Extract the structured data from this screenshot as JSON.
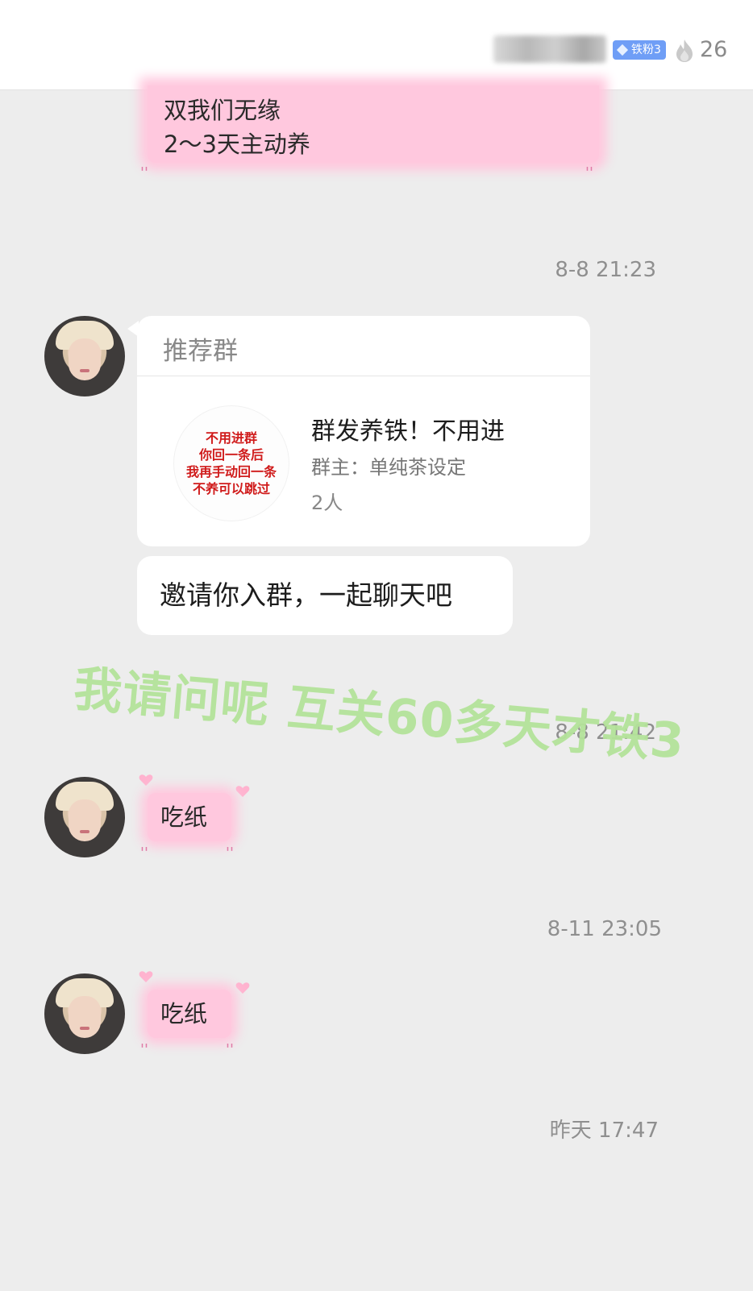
{
  "header": {
    "fan_badge": "铁粉3",
    "fire_count": "26"
  },
  "messages": {
    "top_bubble_lines": [
      "双我们无缘",
      "2～3天主动养"
    ],
    "timestamp_1": "8-8 21:23",
    "group_card": {
      "title": "推荐群",
      "logo_lines": [
        "不用进群",
        "你回一条后",
        "我再手动回一条",
        "不养可以跳过"
      ],
      "name": "群发养铁！不用进",
      "owner": "群主：单纯茶设定",
      "member_count": "2人"
    },
    "invite_text": "邀请你入群，一起聊天吧",
    "overlay_caption": "我请问呢 互关60多天才铁3",
    "timestamp_2": "8-8 21:42",
    "bubble_2": "吃纸",
    "timestamp_3": "8-11 23:05",
    "bubble_3": "吃纸",
    "timestamp_4": "昨天 17:47"
  },
  "colors": {
    "pink_bubble": "#ffc8de",
    "badge_blue": "#6f9ef6",
    "overlay_green": "#b4e39a",
    "background": "#ededed"
  },
  "icons": [
    "flame-icon",
    "diamond-icon",
    "heart-icon"
  ]
}
